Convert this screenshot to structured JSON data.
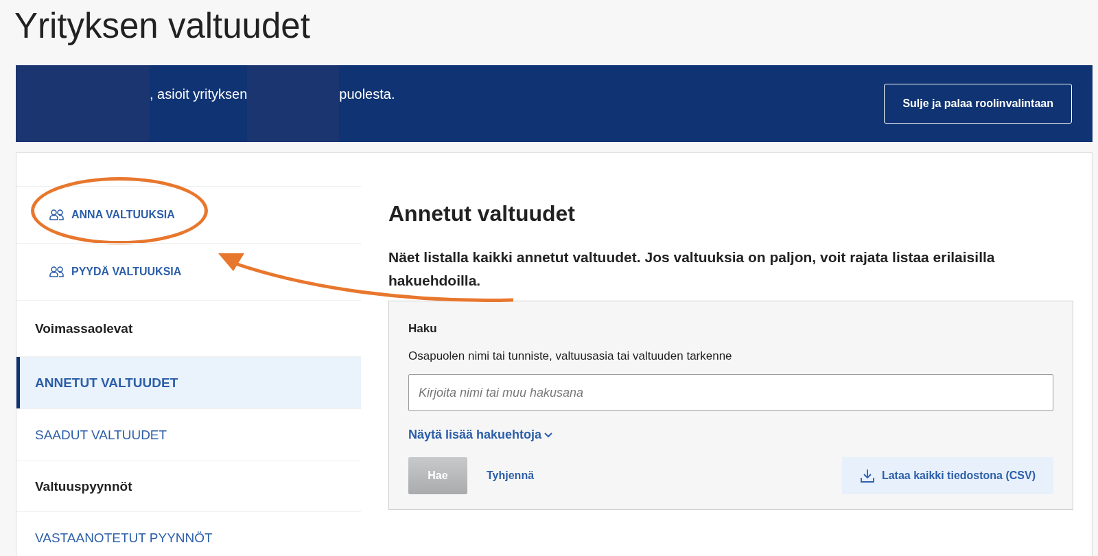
{
  "page_title": "Yrityksen valtuudet",
  "banner": {
    "segments": [
      {
        "kind": "redacted"
      },
      {
        "kind": "text",
        "text": ", asioit yrityksen"
      },
      {
        "kind": "redacted"
      },
      {
        "kind": "text",
        "text": "puolesta."
      }
    ],
    "button": "Sulje ja palaa roolinvalintaan"
  },
  "sidebar": {
    "items": [
      {
        "kind": "action",
        "label": "ANNA VALTUUKSIA",
        "highlighted": true
      },
      {
        "kind": "action",
        "label": "PYYDÄ VALTUUKSIA",
        "highlighted": false
      },
      {
        "kind": "heading",
        "label": "Voimassaolevat"
      },
      {
        "kind": "link",
        "label": "ANNETUT VALTUUDET",
        "selected": true
      },
      {
        "kind": "link",
        "label": "SAADUT VALTUUDET",
        "selected": false
      },
      {
        "kind": "heading",
        "label": "Valtuuspyynnöt"
      },
      {
        "kind": "link",
        "label": "VASTAANOTETUT PYYNNÖT",
        "selected": false
      }
    ]
  },
  "main": {
    "heading": "Annetut valtuudet",
    "intro": "Näet listalla kaikki annetut valtuudet. Jos valtuuksia on paljon, voit rajata listaa erilaisilla hakuehdoilla.",
    "search": {
      "title": "Haku",
      "label": "Osapuolen nimi tai tunniste, valtuusasia tai valtuuden tarkenne",
      "placeholder": "Kirjoita nimi tai muu hakusana",
      "more": "Näytä lisää hakuehtoja",
      "search_button": "Hae",
      "search_disabled": true,
      "clear": "Tyhjennä",
      "download": "Lataa kaikki tiedostona (CSV)"
    }
  }
}
